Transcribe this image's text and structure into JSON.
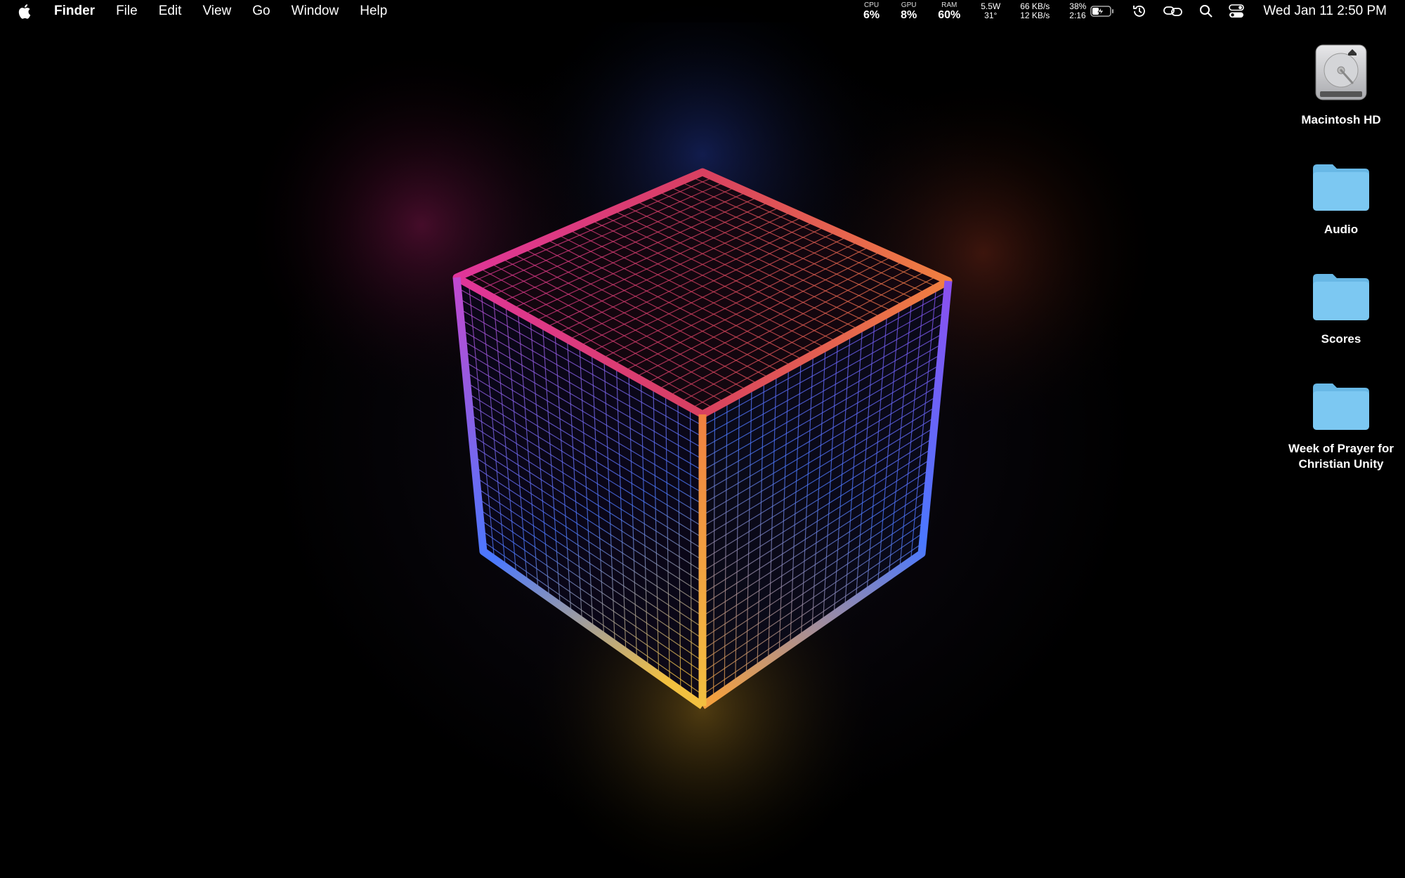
{
  "menubar": {
    "apple_icon": "apple-logo-icon",
    "app_name": "Finder",
    "menus": [
      "File",
      "Edit",
      "View",
      "Go",
      "Window",
      "Help"
    ],
    "cpu": {
      "label": "CPU",
      "value": "6%"
    },
    "gpu": {
      "label": "GPU",
      "value": "8%"
    },
    "ram": {
      "label": "RAM",
      "value": "60%"
    },
    "power": {
      "watts": "5.5W",
      "temp": "31°"
    },
    "network": {
      "down": "66 KB/s",
      "up": "12 KB/s"
    },
    "battery": {
      "percent": "38%",
      "time": "2:16",
      "level": 0.38,
      "charging": true
    },
    "icons": [
      "time-machine-icon",
      "screen-mirroring-icon",
      "spotlight-search-icon",
      "control-center-icon"
    ],
    "clock": "Wed Jan 11  2:50 PM"
  },
  "desktop": {
    "items": [
      {
        "label": "Macintosh HD",
        "icon": "hard-drive-icon"
      },
      {
        "label": "Audio",
        "icon": "folder-icon"
      },
      {
        "label": "Scores",
        "icon": "folder-icon"
      },
      {
        "label": "Week of Prayer for Christian Unity",
        "icon": "folder-icon"
      }
    ]
  },
  "colors": {
    "folder": "#7cc8f2",
    "folder_tab": "#68b8e6",
    "cube_magenta": "#e0359a",
    "cube_orange": "#f08040",
    "cube_blue": "#4a78ff",
    "cube_yellow": "#f2c040",
    "cube_violet": "#8a50f0"
  }
}
